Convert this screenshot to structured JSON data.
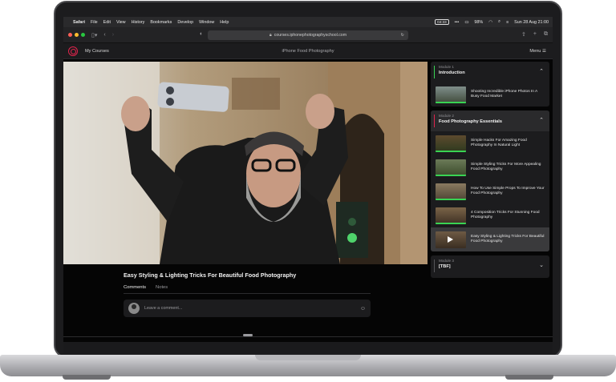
{
  "menubar": {
    "app": "Safari",
    "items": [
      "File",
      "Edit",
      "View",
      "History",
      "Bookmarks",
      "Develop",
      "Window",
      "Help"
    ],
    "status": {
      "ellipsis": "•••",
      "battery": "98%",
      "datetime": "Sun 28 Aug  21:00",
      "badge": "04:33"
    }
  },
  "browser": {
    "url": "courses.iphonephotographyschool.com",
    "traffic_light_colors": [
      "#ff5f57",
      "#febc2e",
      "#28c840"
    ]
  },
  "header": {
    "my_courses": "My Courses",
    "course_title": "iPhone Food Photography",
    "menu": "Menu"
  },
  "lesson": {
    "title": "Easy Styling & Lighting Tricks For Beautiful Food Photography",
    "tabs": [
      "Comments",
      "Notes"
    ],
    "comment_placeholder": "Leave a comment..."
  },
  "sidebar": {
    "modules": [
      {
        "label": "Module 1",
        "title": "Introduction",
        "accent": "#39d353",
        "expanded": true,
        "lessons": [
          {
            "title": "Shooting Incredible iPhone Photos In A Busy Food Market",
            "progress": 1.0,
            "current": false
          }
        ]
      },
      {
        "label": "Module 2",
        "title": "Food Photography Essentials",
        "accent": "#e0244c",
        "expanded": true,
        "lessons": [
          {
            "title": "Simple Hacks For Amazing Food Photography In Natural Light",
            "progress": 1.0,
            "current": false
          },
          {
            "title": "Simple Styling Tricks For More Appealing Food Photography",
            "progress": 1.0,
            "current": false
          },
          {
            "title": "How To Use Simple Props To Improve Your Food Photography",
            "progress": 1.0,
            "current": false
          },
          {
            "title": "4 Composition Tricks For Stunning Food Photography",
            "progress": 1.0,
            "current": false
          },
          {
            "title": "Easy Styling & Lighting Tricks For Beautiful Food Photography",
            "progress": 0.0,
            "current": true
          }
        ]
      },
      {
        "label": "Module 3",
        "title": "[TBF]",
        "accent": "#555558",
        "expanded": false,
        "lessons": []
      }
    ]
  }
}
